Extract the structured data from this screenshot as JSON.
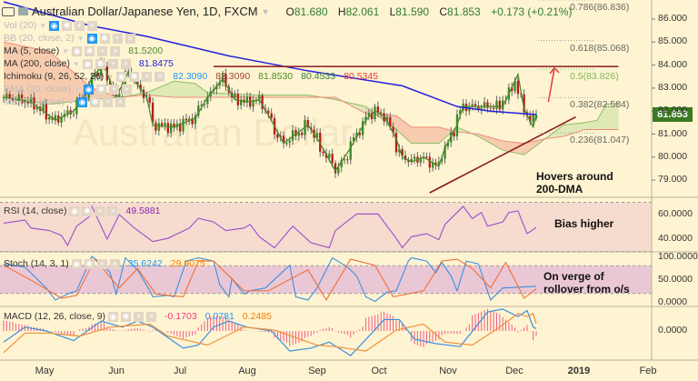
{
  "header": {
    "title": "Australian Dollar/Japanese Yen, 1D, FXCM",
    "open_label": "O",
    "open": "81.680",
    "high_label": "H",
    "high": "82.061",
    "low_label": "L",
    "low": "81.590",
    "close_label": "C",
    "close": "81.853",
    "change": "+0.173 (+0.21%)"
  },
  "legend": [
    {
      "label": "Vol (20)",
      "value": "",
      "faded": true,
      "eye_on": true
    },
    {
      "label": "BB (20, close, 2)",
      "value": "",
      "faded": true,
      "eye_on": true
    },
    {
      "label": "MA (5, close)",
      "value": "81.5200",
      "color": "#4a8a2a"
    },
    {
      "label": "MA (200, close)",
      "value": "81.8475",
      "color": "#2222dd"
    },
    {
      "label": "Ichimoku (9, 26, 52, 26)",
      "values": [
        "82.3090",
        "82.3090",
        "81.8530",
        "80.4533",
        "80.5345"
      ],
      "colors": [
        "#2196f3",
        "#a0443a",
        "#4a8a2a",
        "#2e7d32",
        "#e53935"
      ]
    },
    {
      "label": "EMA (20, close)",
      "value": "",
      "faded": true,
      "eye_on": true
    },
    {
      "label": "MA (20, close)",
      "value": "",
      "faded": true,
      "eye_on": true
    }
  ],
  "price_axis": {
    "ticks": [
      "86.000",
      "85.000",
      "84.000",
      "83.000",
      "82.000",
      "81.000",
      "80.000",
      "79.000"
    ],
    "current": "81.853",
    "current_color": "#3b7a22"
  },
  "time_axis": [
    "May",
    "Jun",
    "Jul",
    "Aug",
    "Sep",
    "Oct",
    "Nov",
    "Dec",
    "2019",
    "Feb"
  ],
  "annotations": {
    "main_1": "Hovers around",
    "main_2": "200-DMA",
    "rsi": "Bias higher",
    "stoch_1": "On verge of",
    "stoch_2": "rollover from o/s"
  },
  "fib_levels": [
    {
      "label": "0.786(86.836)",
      "price": 86.836
    },
    {
      "label": "0.618(85.068)",
      "price": 85.068
    },
    {
      "label": "0.5(83.826)",
      "price": 83.826,
      "color": "#7cb85a"
    },
    {
      "label": "0.382(82.584)",
      "price": 82.584
    },
    {
      "label": "0.236(81.047)",
      "price": 81.047
    }
  ],
  "rsi": {
    "label": "RSI (14, close)",
    "value": "49.5881",
    "ticks": [
      "60.0000",
      "40.0000"
    ]
  },
  "stoch": {
    "label": "Stoch (14, 3, 1)",
    "k_value": "35.6242",
    "d_value": "29.9075",
    "ticks": [
      "100.0000",
      "50.0000",
      "0.0000"
    ]
  },
  "macd": {
    "label": "MACD (12, 26, close, 9)",
    "hist_value": "-0.1703",
    "macd_value": "0.0781",
    "signal_value": "0.2485",
    "ticks": [
      "0.0000"
    ]
  },
  "chart_data": {
    "type": "candlestick",
    "symbol": "AUDJPY",
    "ylim": [
      78.3,
      86.8
    ],
    "last_candle": {
      "open": 81.68,
      "high": 82.061,
      "low": 81.59,
      "close": 81.853
    },
    "close_path": [
      [
        "2018-04-10",
        82.6
      ],
      [
        "2018-04-22",
        82.4
      ],
      [
        "2018-05-03",
        81.6
      ],
      [
        "2018-05-11",
        82.0
      ],
      [
        "2018-05-17",
        82.75
      ],
      [
        "2018-05-21",
        83.5
      ],
      [
        "2018-05-25",
        84.0
      ],
      [
        "2018-05-31",
        82.6
      ],
      [
        "2018-06-06",
        83.7
      ],
      [
        "2018-06-14",
        82.6
      ],
      [
        "2018-06-18",
        81.4
      ],
      [
        "2018-06-27",
        81.3
      ],
      [
        "2018-07-06",
        81.7
      ],
      [
        "2018-07-12",
        82.6
      ],
      [
        "2018-07-19",
        83.4
      ],
      [
        "2018-07-25",
        82.5
      ],
      [
        "2018-07-31",
        82.4
      ],
      [
        "2018-08-06",
        82.5
      ],
      [
        "2018-08-10",
        81.6
      ],
      [
        "2018-08-16",
        80.6
      ],
      [
        "2018-08-22",
        81.0
      ],
      [
        "2018-08-28",
        81.4
      ],
      [
        "2018-09-01",
        80.6
      ],
      [
        "2018-09-10",
        79.4
      ],
      [
        "2018-09-16",
        80.4
      ],
      [
        "2018-09-22",
        81.6
      ],
      [
        "2018-09-27",
        82.0
      ],
      [
        "2018-10-02",
        81.8
      ],
      [
        "2018-10-06",
        80.8
      ],
      [
        "2018-10-10",
        80.0
      ],
      [
        "2018-10-14",
        79.8
      ],
      [
        "2018-10-19",
        80.0
      ],
      [
        "2018-10-26",
        79.6
      ],
      [
        "2018-10-30",
        80.4
      ],
      [
        "2018-11-03",
        81.4
      ],
      [
        "2018-11-07",
        82.2
      ],
      [
        "2018-11-14",
        82.2
      ],
      [
        "2018-11-20",
        82.2
      ],
      [
        "2018-11-24",
        82.2
      ],
      [
        "2018-11-28",
        82.75
      ],
      [
        "2018-12-01",
        83.6
      ],
      [
        "2018-12-05",
        82.1
      ],
      [
        "2018-12-08",
        81.3
      ],
      [
        "2018-12-11",
        81.853
      ]
    ],
    "ma200": [
      [
        "2018-04-10",
        86.75
      ],
      [
        "2018-05-21",
        85.7
      ],
      [
        "2018-06-14",
        85.25
      ],
      [
        "2018-07-22",
        84.4
      ],
      [
        "2018-08-28",
        83.75
      ],
      [
        "2018-10-10",
        83.1
      ],
      [
        "2018-11-03",
        82.2
      ],
      [
        "2018-11-20",
        82.0
      ],
      [
        "2018-12-11",
        81.85
      ]
    ],
    "ichimoku_cloud": [
      [
        "2018-04-10",
        82.6,
        85.0
      ],
      [
        "2018-05-01",
        82.3,
        84.6
      ],
      [
        "2018-05-21",
        82.5,
        83.0
      ],
      [
        "2018-06-01",
        82.6,
        82.6
      ],
      [
        "2018-06-14",
        82.8,
        82.7
      ],
      [
        "2018-06-27",
        83.3,
        82.6
      ],
      [
        "2018-07-06",
        83.2,
        82.6
      ],
      [
        "2018-07-12",
        82.8,
        82.6
      ],
      [
        "2018-08-06",
        82.7,
        82.6
      ],
      [
        "2018-08-28",
        82.7,
        82.6
      ],
      [
        "2018-09-10",
        82.5,
        82.6
      ],
      [
        "2018-09-22",
        82.2,
        81.9
      ],
      [
        "2018-10-06",
        81.2,
        81.8
      ],
      [
        "2018-10-14",
        80.6,
        81.3
      ],
      [
        "2018-10-26",
        80.6,
        81.3
      ],
      [
        "2018-11-03",
        81.3,
        81.1
      ],
      [
        "2018-11-14",
        80.9,
        81.0
      ],
      [
        "2018-11-24",
        80.3,
        80.7
      ],
      [
        "2018-12-05",
        80.1,
        80.6
      ],
      [
        "2018-12-14",
        80.8,
        80.8
      ],
      [
        "2018-12-24",
        81.4,
        80.9
      ],
      [
        "2019-01-02",
        81.5,
        81.2
      ],
      [
        "2019-01-08",
        81.6,
        81.2
      ],
      [
        "2019-01-11",
        82.3,
        81.2
      ],
      [
        "2019-01-17",
        82.35,
        81.2
      ]
    ],
    "resistance": {
      "price": 83.94,
      "from": "2018-07-16",
      "to": "2019-01-17"
    },
    "trendline": [
      [
        "2018-10-23",
        78.45
      ],
      [
        "2018-12-28",
        81.75
      ]
    ],
    "arrow": [
      [
        "2018-12-17",
        82.4
      ],
      [
        "2018-12-19",
        83.87
      ]
    ],
    "fib_range": [
      "2018-12-11",
      "2019-01-07"
    ],
    "rsi": [
      [
        "2018-04-10",
        53
      ],
      [
        "2018-04-19",
        55.5
      ],
      [
        "2018-04-23",
        49
      ],
      [
        "2018-05-01",
        47
      ],
      [
        "2018-05-07",
        43
      ],
      [
        "2018-05-09",
        35
      ],
      [
        "2018-05-12",
        50.6
      ],
      [
        "2018-05-18",
        58
      ],
      [
        "2018-05-21",
        66.7
      ],
      [
        "2018-05-28",
        40
      ],
      [
        "2018-06-01",
        60
      ],
      [
        "2018-06-08",
        49
      ],
      [
        "2018-06-17",
        38
      ],
      [
        "2018-06-25",
        40.7
      ],
      [
        "2018-07-04",
        49
      ],
      [
        "2018-07-08",
        57
      ],
      [
        "2018-07-16",
        54
      ],
      [
        "2018-07-20",
        47
      ],
      [
        "2018-07-28",
        49
      ],
      [
        "2018-08-01",
        52
      ],
      [
        "2018-08-06",
        42
      ],
      [
        "2018-08-13",
        33
      ],
      [
        "2018-08-21",
        50.6
      ],
      [
        "2018-08-29",
        37
      ],
      [
        "2018-09-06",
        33
      ],
      [
        "2018-09-10",
        47
      ],
      [
        "2018-09-19",
        60.5
      ],
      [
        "2018-09-28",
        60.5
      ],
      [
        "2018-10-06",
        40.7
      ],
      [
        "2018-10-10",
        33
      ],
      [
        "2018-10-14",
        42
      ],
      [
        "2018-10-22",
        44.4
      ],
      [
        "2018-10-26",
        39.5
      ],
      [
        "2018-10-30",
        52
      ],
      [
        "2018-11-07",
        66.7
      ],
      [
        "2018-11-11",
        56.8
      ],
      [
        "2018-11-15",
        61.7
      ],
      [
        "2018-11-19",
        50.6
      ],
      [
        "2018-11-26",
        54
      ],
      [
        "2018-11-28",
        61.7
      ],
      [
        "2018-12-02",
        63
      ],
      [
        "2018-12-06",
        44.4
      ],
      [
        "2018-12-11",
        49.59
      ]
    ],
    "rsi_bands": [
      70,
      30
    ],
    "stoch_k": [
      [
        "2018-04-10",
        84
      ],
      [
        "2018-04-19",
        77
      ],
      [
        "2018-04-28",
        32
      ],
      [
        "2018-05-03",
        6
      ],
      [
        "2018-05-09",
        19
      ],
      [
        "2018-05-13",
        26
      ],
      [
        "2018-05-19",
        100
      ],
      [
        "2018-05-23",
        90
      ],
      [
        "2018-05-29",
        65
      ],
      [
        "2018-05-31",
        19
      ],
      [
        "2018-06-05",
        97
      ],
      [
        "2018-06-10",
        71
      ],
      [
        "2018-06-15",
        26
      ],
      [
        "2018-06-18",
        13
      ],
      [
        "2018-06-23",
        16
      ],
      [
        "2018-06-27",
        13
      ],
      [
        "2018-07-03",
        90
      ],
      [
        "2018-07-07",
        97
      ],
      [
        "2018-07-14",
        90
      ],
      [
        "2018-07-18",
        39
      ],
      [
        "2018-07-21",
        13
      ],
      [
        "2018-07-24",
        52
      ],
      [
        "2018-07-28",
        19
      ],
      [
        "2018-08-01",
        26
      ],
      [
        "2018-08-08",
        32
      ],
      [
        "2018-08-19",
        81
      ],
      [
        "2018-08-22",
        13
      ],
      [
        "2018-08-28",
        6
      ],
      [
        "2018-08-31",
        32
      ],
      [
        "2018-09-07",
        97
      ],
      [
        "2018-09-14",
        77
      ],
      [
        "2018-09-19",
        58
      ],
      [
        "2018-09-23",
        13
      ],
      [
        "2018-09-27",
        3
      ],
      [
        "2018-10-03",
        23
      ],
      [
        "2018-10-08",
        26
      ],
      [
        "2018-10-12",
        90
      ],
      [
        "2018-10-15",
        97
      ],
      [
        "2018-10-21",
        90
      ],
      [
        "2018-10-25",
        65
      ],
      [
        "2018-10-28",
        87
      ],
      [
        "2018-11-01",
        58
      ],
      [
        "2018-11-05",
        26
      ],
      [
        "2018-11-08",
        90
      ],
      [
        "2018-11-14",
        84
      ],
      [
        "2018-11-20",
        6
      ],
      [
        "2018-11-24",
        32
      ],
      [
        "2018-12-11",
        35.62
      ]
    ],
    "stoch_d": [
      [
        "2018-04-10",
        81
      ],
      [
        "2018-04-24",
        45
      ],
      [
        "2018-05-06",
        10
      ],
      [
        "2018-05-12",
        16
      ],
      [
        "2018-05-22",
        94
      ],
      [
        "2018-06-01",
        32
      ],
      [
        "2018-06-09",
        74
      ],
      [
        "2018-06-19",
        19
      ],
      [
        "2018-06-30",
        13
      ],
      [
        "2018-07-08",
        90
      ],
      [
        "2018-07-16",
        90
      ],
      [
        "2018-07-28",
        26
      ],
      [
        "2018-08-09",
        26
      ],
      [
        "2018-08-28",
        71
      ],
      [
        "2018-09-05",
        6
      ],
      [
        "2018-09-17",
        94
      ],
      [
        "2018-09-27",
        81
      ],
      [
        "2018-10-05",
        13
      ],
      [
        "2018-10-19",
        26
      ],
      [
        "2018-10-27",
        90
      ],
      [
        "2018-11-04",
        94
      ],
      [
        "2018-11-12",
        74
      ],
      [
        "2018-11-20",
        32
      ],
      [
        "2018-11-27",
        87
      ],
      [
        "2018-12-05",
        10
      ],
      [
        "2018-12-11",
        29.91
      ]
    ],
    "stoch_bands": [
      80,
      20
    ],
    "macd_line": [
      [
        "2018-04-10",
        -0.37
      ],
      [
        "2018-04-19",
        0.13
      ],
      [
        "2018-04-28",
        0
      ],
      [
        "2018-05-11",
        -0.32
      ],
      [
        "2018-05-24",
        0.33
      ],
      [
        "2018-06-02",
        0.13
      ],
      [
        "2018-06-10",
        0.33
      ],
      [
        "2018-06-18",
        0.13
      ],
      [
        "2018-07-01",
        -0.57
      ],
      [
        "2018-07-07",
        -0.47
      ],
      [
        "2018-07-14",
        0.13
      ],
      [
        "2018-07-22",
        0.33
      ],
      [
        "2018-07-31",
        0.13
      ],
      [
        "2018-08-10",
        0
      ],
      [
        "2018-08-20",
        -0.67
      ],
      [
        "2018-08-29",
        -0.57
      ],
      [
        "2018-09-06",
        -0.37
      ],
      [
        "2018-09-17",
        -0.82
      ],
      [
        "2018-09-26",
        -0.07
      ],
      [
        "2018-10-02",
        0.38
      ],
      [
        "2018-10-09",
        0.38
      ],
      [
        "2018-10-16",
        -0.27
      ],
      [
        "2018-10-25",
        -0.42
      ],
      [
        "2018-11-06",
        -0.52
      ],
      [
        "2018-11-18",
        0.63
      ],
      [
        "2018-11-26",
        0.73
      ],
      [
        "2018-12-02",
        0.48
      ],
      [
        "2018-12-06",
        0.68
      ],
      [
        "2018-12-09",
        0.13
      ],
      [
        "2018-12-11",
        0.0781
      ]
    ],
    "macd_signal": [
      [
        "2018-04-10",
        -0.72
      ],
      [
        "2018-04-19",
        -0.07
      ],
      [
        "2018-05-01",
        -0.07
      ],
      [
        "2018-05-15",
        -0.17
      ],
      [
        "2018-05-29",
        0.13
      ],
      [
        "2018-06-15",
        0.23
      ],
      [
        "2018-06-24",
        -0.17
      ],
      [
        "2018-07-12",
        -0.47
      ],
      [
        "2018-07-29",
        0.13
      ],
      [
        "2018-08-13",
        0.03
      ],
      [
        "2018-08-31",
        -0.47
      ],
      [
        "2018-09-10",
        -0.52
      ],
      [
        "2018-09-24",
        -0.67
      ],
      [
        "2018-10-08",
        0.03
      ],
      [
        "2018-10-19",
        0.23
      ],
      [
        "2018-10-30",
        -0.37
      ],
      [
        "2018-11-12",
        -0.47
      ],
      [
        "2018-11-23",
        0.13
      ],
      [
        "2018-12-03",
        0.58
      ],
      [
        "2018-12-06",
        0.48
      ],
      [
        "2018-12-09",
        0.58
      ],
      [
        "2018-12-11",
        0.2485
      ]
    ]
  }
}
